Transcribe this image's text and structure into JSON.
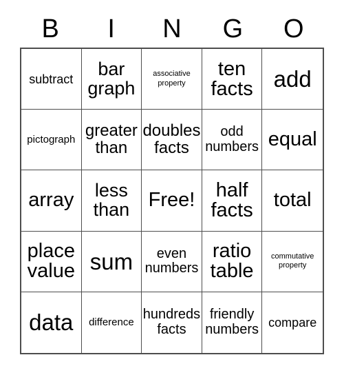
{
  "card": {
    "title": "BINGO",
    "header_letters": [
      "B",
      "I",
      "N",
      "G",
      "O"
    ],
    "free_space_label": "Free!",
    "colors": {
      "background": "#ffffff",
      "text": "#000000",
      "grid_line": "#4d4d4d"
    },
    "grid": {
      "columns": 5,
      "rows": 5,
      "cells": [
        {
          "text": "subtract",
          "size": "md"
        },
        {
          "text": "bar\ngraph",
          "size": "2xl"
        },
        {
          "text": "associative\nproperty",
          "size": "xs"
        },
        {
          "text": "ten\nfacts",
          "size": "3xl"
        },
        {
          "text": "add",
          "size": "4xl"
        },
        {
          "text": "pictograph",
          "size": "sm"
        },
        {
          "text": "greater\nthan",
          "size": "xl"
        },
        {
          "text": "doubles\nfacts",
          "size": "xl"
        },
        {
          "text": "odd\nnumbers",
          "size": "lg"
        },
        {
          "text": "equal",
          "size": "3xl"
        },
        {
          "text": "array",
          "size": "3xl"
        },
        {
          "text": "less\nthan",
          "size": "2xl"
        },
        {
          "text": "Free!",
          "size": "3xl"
        },
        {
          "text": "half\nfacts",
          "size": "3xl"
        },
        {
          "text": "total",
          "size": "3xl"
        },
        {
          "text": "place\nvalue",
          "size": "3xl"
        },
        {
          "text": "sum",
          "size": "4xl"
        },
        {
          "text": "even\nnumbers",
          "size": "lg"
        },
        {
          "text": "ratio\ntable",
          "size": "3xl"
        },
        {
          "text": "commutative\nproperty",
          "size": "xs"
        },
        {
          "text": "data",
          "size": "4xl"
        },
        {
          "text": "difference",
          "size": "sm"
        },
        {
          "text": "hundreds\nfacts",
          "size": "lg"
        },
        {
          "text": "friendly\nnumbers",
          "size": "lg"
        },
        {
          "text": "compare",
          "size": "md"
        }
      ]
    }
  }
}
